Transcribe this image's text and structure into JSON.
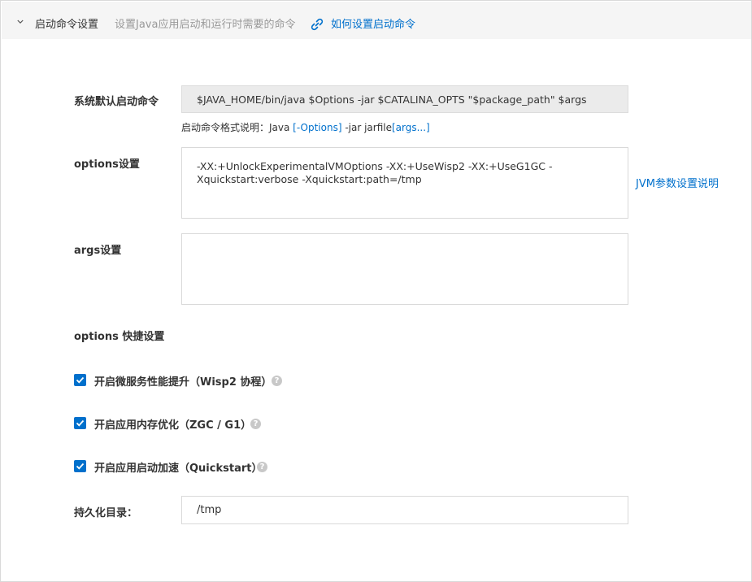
{
  "header": {
    "title": "启动命令设置",
    "description": "设置Java应用启动和运行时需要的命令",
    "help_link": "如何设置启动命令"
  },
  "default_command": {
    "label": "系统默认启动命令",
    "value": "$JAVA_HOME/bin/java $Options -jar $CATALINA_OPTS \"$package_path\" $args",
    "format_prefix": "启动命令格式说明：Java ",
    "format_options": "[-Options]",
    "format_middle": " -jar jarfile",
    "format_args": "[args...]"
  },
  "options": {
    "label": "options设置",
    "value": "-XX:+UnlockExperimentalVMOptions -XX:+UseWisp2 -XX:+UseG1GC -Xquickstart:verbose -Xquickstart:path=/tmp",
    "side_link": "JVM参数设置说明"
  },
  "args": {
    "label": "args设置",
    "value": ""
  },
  "quick": {
    "label": "options 快捷设置",
    "items": [
      {
        "label": "开启微服务性能提升（Wisp2 协程）",
        "checked": true
      },
      {
        "label": "开启应用内存优化（ZGC / G1）",
        "checked": true
      },
      {
        "label": "开启应用启动加速（Quickstart）",
        "checked": true
      }
    ]
  },
  "persist": {
    "label": "持久化目录：",
    "value": "/tmp"
  },
  "colors": {
    "accent": "#0070cc",
    "header_bg": "#f5f5f5",
    "readonly_bg": "#ebebeb"
  }
}
